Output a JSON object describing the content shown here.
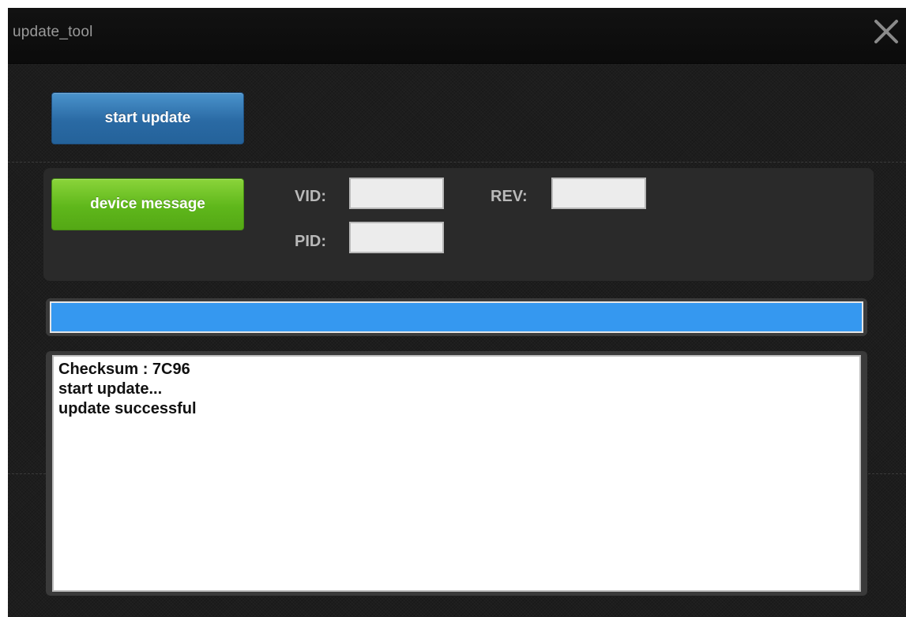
{
  "window": {
    "title": "update_tool"
  },
  "actions": {
    "start_update_label": "start update",
    "device_message_label": "device message"
  },
  "device": {
    "vid_label": "VID:",
    "vid_value": "",
    "pid_label": "PID:",
    "pid_value": "",
    "rev_label": "REV:",
    "rev_value": ""
  },
  "progress": {
    "fraction": 1.0
  },
  "log": {
    "lines": [
      "Checksum : 7C96",
      "start update...",
      "update successful"
    ]
  },
  "colors": {
    "start_button": "#2a6aa4",
    "device_button": "#5fb71b",
    "progress_fill": "#3598f0",
    "window_background": "#1d1d1d"
  },
  "icons": {
    "close": "close-icon"
  }
}
